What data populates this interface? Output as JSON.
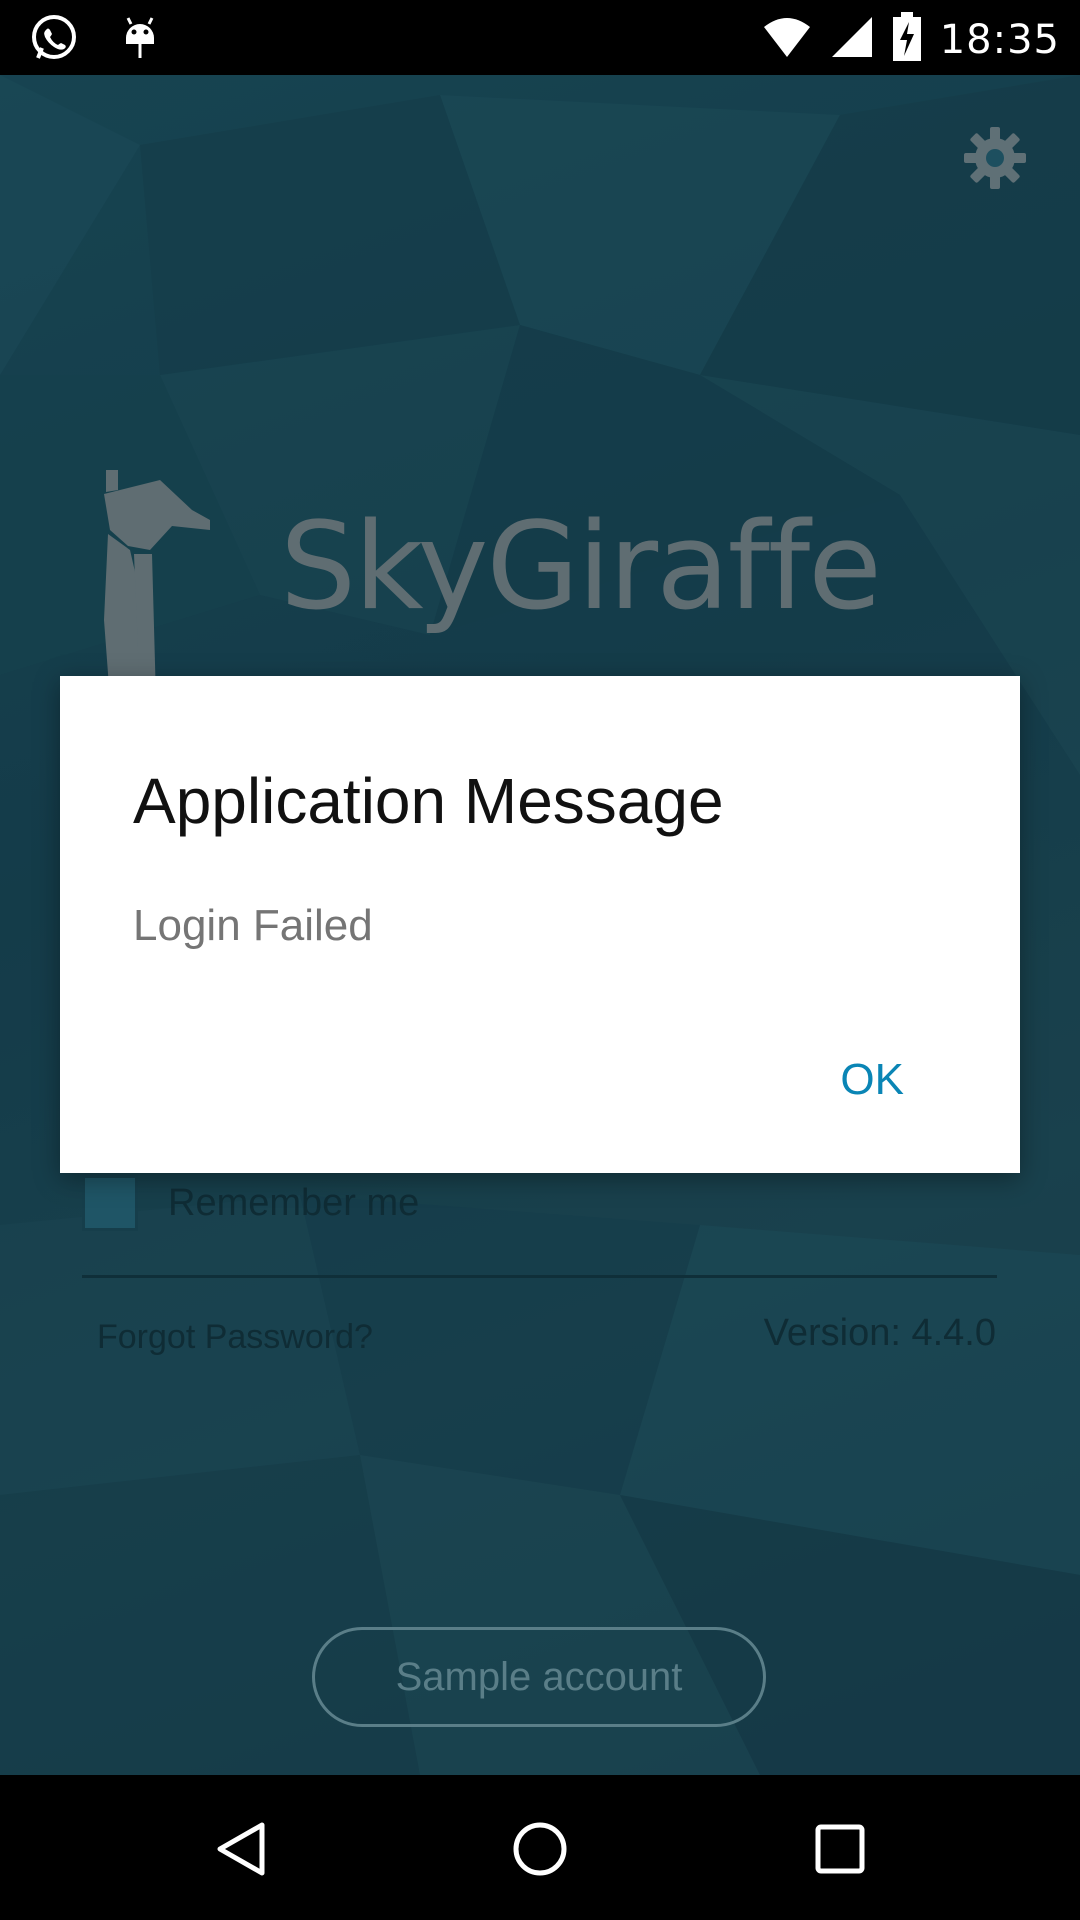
{
  "status_bar": {
    "time": "18:35",
    "left_icons": [
      "whatsapp-icon",
      "android-debug-icon"
    ],
    "right_icons": [
      "wifi-icon",
      "cell-signal-icon",
      "battery-charging-icon"
    ]
  },
  "app": {
    "settings_icon": "gear-icon",
    "logo_text": "SkyGiraffe",
    "remember_label": "Remember me",
    "remember_checked": false,
    "forgot_password": "Forgot Password?",
    "version": "Version: 4.4.0",
    "sample_account": "Sample account"
  },
  "dialog": {
    "title": "Application Message",
    "message": "Login Failed",
    "ok_label": "OK"
  },
  "nav_bar": {
    "buttons": [
      "back-icon",
      "home-icon",
      "recents-icon"
    ]
  },
  "colors": {
    "background": "#1e5768",
    "accent": "#0a85b5",
    "dialog": "#ffffff"
  }
}
